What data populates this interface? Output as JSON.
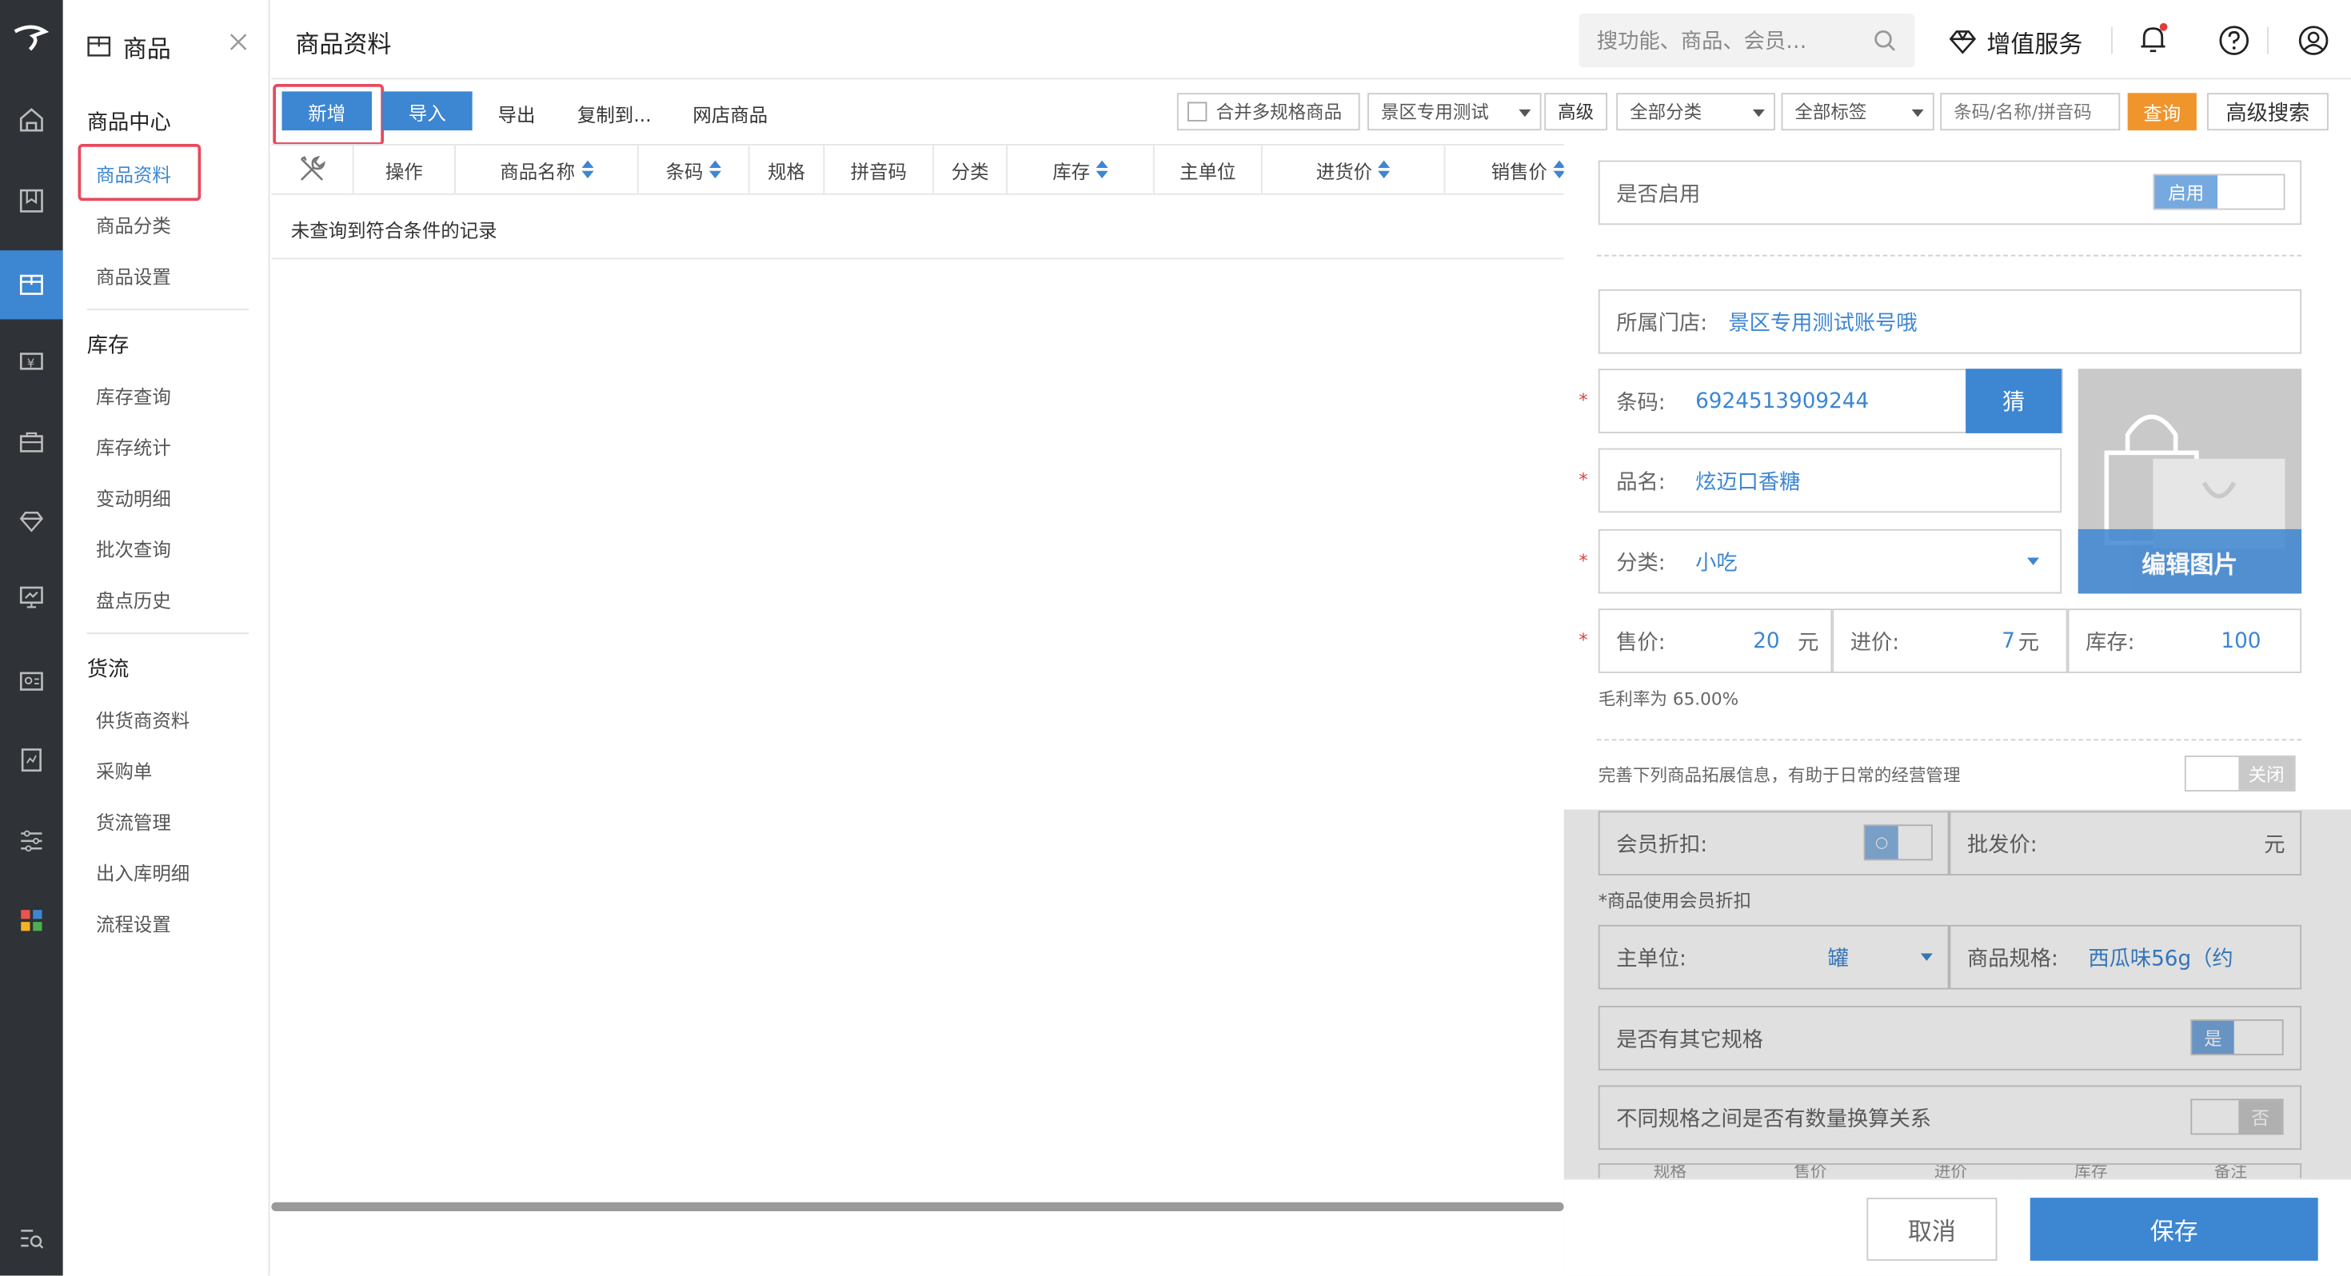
{
  "app": {
    "module_title": "商品",
    "page_title": "商品资料"
  },
  "header": {
    "search_placeholder": "搜功能、商品、会员…",
    "vip_label": "增值服务"
  },
  "sidebar": {
    "sec1": "商品中心",
    "items1": [
      "商品资料",
      "商品分类",
      "商品设置"
    ],
    "sec2": "库存",
    "items2": [
      "库存查询",
      "库存统计",
      "变动明细",
      "批次查询",
      "盘点历史"
    ],
    "sec3": "货流",
    "items3": [
      "供货商资料",
      "采购单",
      "货流管理",
      "出入库明细",
      "流程设置"
    ]
  },
  "toolbar": {
    "new": "新增",
    "import": "导入",
    "export": "导出",
    "copy": "复制到...",
    "web": "网店商品",
    "merge": "合并多规格商品",
    "store": "景区专用测试",
    "advanced": "高级",
    "all_cat": "全部分类",
    "all_tag": "全部标签",
    "search_ph": "条码/名称/拼音码",
    "query": "查询",
    "adv_search": "高级搜索"
  },
  "table": {
    "headers": [
      "操作",
      "商品名称",
      "条码",
      "规格",
      "拼音码",
      "分类",
      "库存",
      "主单位",
      "进货价",
      "销售价"
    ],
    "empty": "未查询到符合条件的记录"
  },
  "form": {
    "enabled_label": "是否启用",
    "enabled_toggle": "启用",
    "store_label": "所属门店:",
    "store_value": "景区专用测试账号哦",
    "barcode_label": "条码:",
    "barcode_value": "6924513909244",
    "guess": "猜",
    "name_label": "品名:",
    "name_value": "炫迈口香糖",
    "cat_label": "分类:",
    "cat_value": "小吃",
    "edit_image": "编辑图片",
    "price_label": "售价:",
    "price_value": "20",
    "price_unit": "元",
    "cost_label": "进价:",
    "cost_value": "7",
    "cost_unit": "元",
    "stock_label": "库存:",
    "stock_value": "100",
    "margin": "毛利率为 65.00%",
    "ext_hint": "完善下列商品拓展信息，有助于日常的经营管理",
    "ext_toggle": "关闭",
    "member_label": "会员折扣:",
    "member_toggle": "○",
    "wholesale_label": "批发价:",
    "wholesale_unit": "元",
    "member_note": "*商品使用会员折扣",
    "unit_label": "主单位:",
    "unit_value": "罐",
    "spec_label": "商品规格:",
    "spec_value": "西瓜味56g（约",
    "other_spec_label": "是否有其它规格",
    "other_spec_toggle": "是",
    "convert_label": "不同规格之间是否有数量换算关系",
    "convert_toggle": "否",
    "sub_headers": [
      "规格",
      "售价",
      "进价",
      "库存",
      "备注"
    ],
    "cancel": "取消",
    "save": "保存"
  },
  "colors": {
    "accent": "#3d86d2",
    "orange": "#f0952c",
    "rail": "#2f3236",
    "highlight": "#e84a5f"
  }
}
